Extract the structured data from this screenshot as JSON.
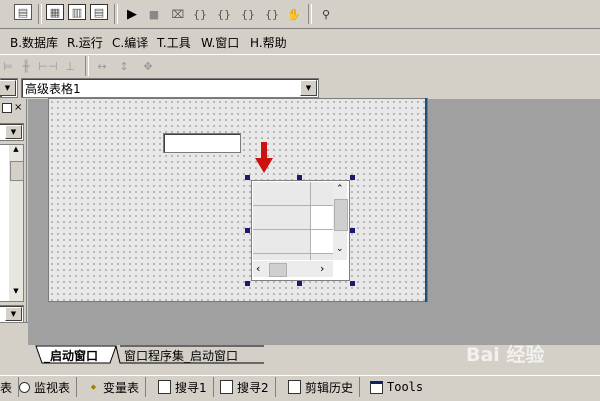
{
  "menu": {
    "items": [
      {
        "key": "B",
        "label": "B.数据库"
      },
      {
        "key": "R",
        "label": "R.运行"
      },
      {
        "key": "C",
        "label": "C.编译"
      },
      {
        "key": "T",
        "label": "T.工具"
      },
      {
        "key": "W",
        "label": "W.窗口"
      },
      {
        "key": "H",
        "label": "H.帮助"
      }
    ]
  },
  "component_selector": {
    "value": "高级表格1"
  },
  "editor_tabs": [
    {
      "label": "_启动窗口"
    },
    {
      "label": "窗口程序集_启动窗口"
    }
  ],
  "status_tabs": [
    {
      "label": "表",
      "icon": "table-icon"
    },
    {
      "label": "监视表",
      "icon": "search-icon"
    },
    {
      "label": "变量表",
      "icon": "variables-icon"
    },
    {
      "label": "搜寻1",
      "icon": "find-icon"
    },
    {
      "label": "搜寻2",
      "icon": "find-icon"
    },
    {
      "label": "剪辑历史",
      "icon": "clip-icon"
    },
    {
      "label": "Tools",
      "icon": "window-icon"
    }
  ],
  "watermark": {
    "text": "Bai 经验"
  },
  "colors": {
    "accent_arrow": "#cc1111",
    "canvas_border": "#1f4e79",
    "selection_handle": "#1a1a6e"
  }
}
